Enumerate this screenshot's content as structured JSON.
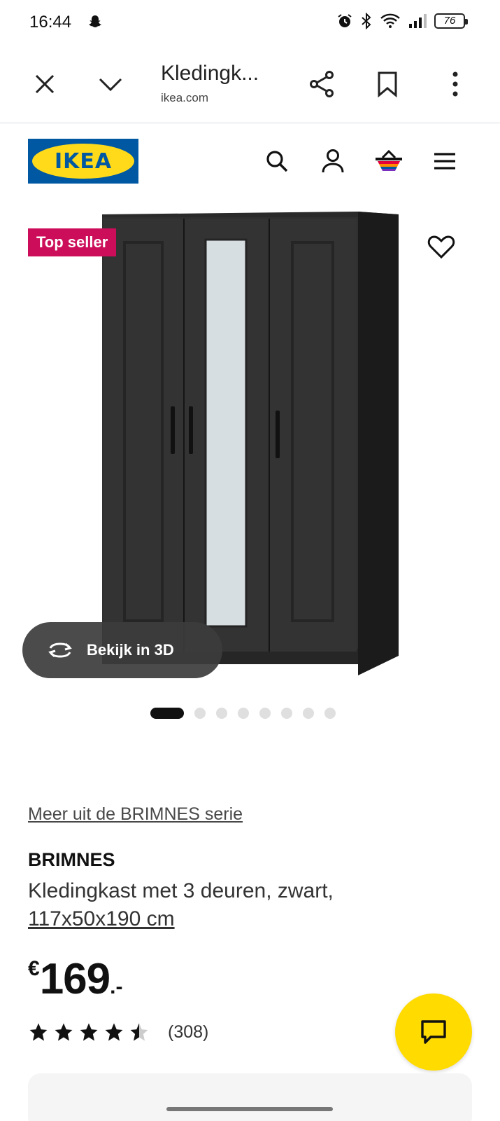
{
  "status_bar": {
    "time": "16:44",
    "battery": "76",
    "icons": [
      "snapchat-icon",
      "alarm-icon",
      "bluetooth-icon",
      "wifi-icon",
      "signal-icon",
      "battery-icon"
    ]
  },
  "browser_toolbar": {
    "title": "Kledingk...",
    "url": "ikea.com"
  },
  "header": {
    "logo_text": "IKEA",
    "icons": [
      "search-icon",
      "account-icon",
      "cart-icon",
      "menu-icon"
    ]
  },
  "product_media": {
    "badge": "Top seller",
    "view_3d_label": "Bekijk in 3D",
    "carousel": {
      "total": 8,
      "active": 1
    }
  },
  "product": {
    "series_link": "Meer uit de BRIMNES serie",
    "name": "BRIMNES",
    "description": "Kledingkast met 3 deuren, zwart,",
    "dimensions": "117x50x190 cm",
    "price_currency": "€",
    "price_value": "169",
    "price_suffix": ".-",
    "rating": 4.5,
    "review_count": "(308)"
  },
  "colors": {
    "ikea_blue": "#0058a3",
    "ikea_yellow": "#ffda1a",
    "badge_pink": "#cc0e5a",
    "chat_yellow": "#ffdb00"
  }
}
